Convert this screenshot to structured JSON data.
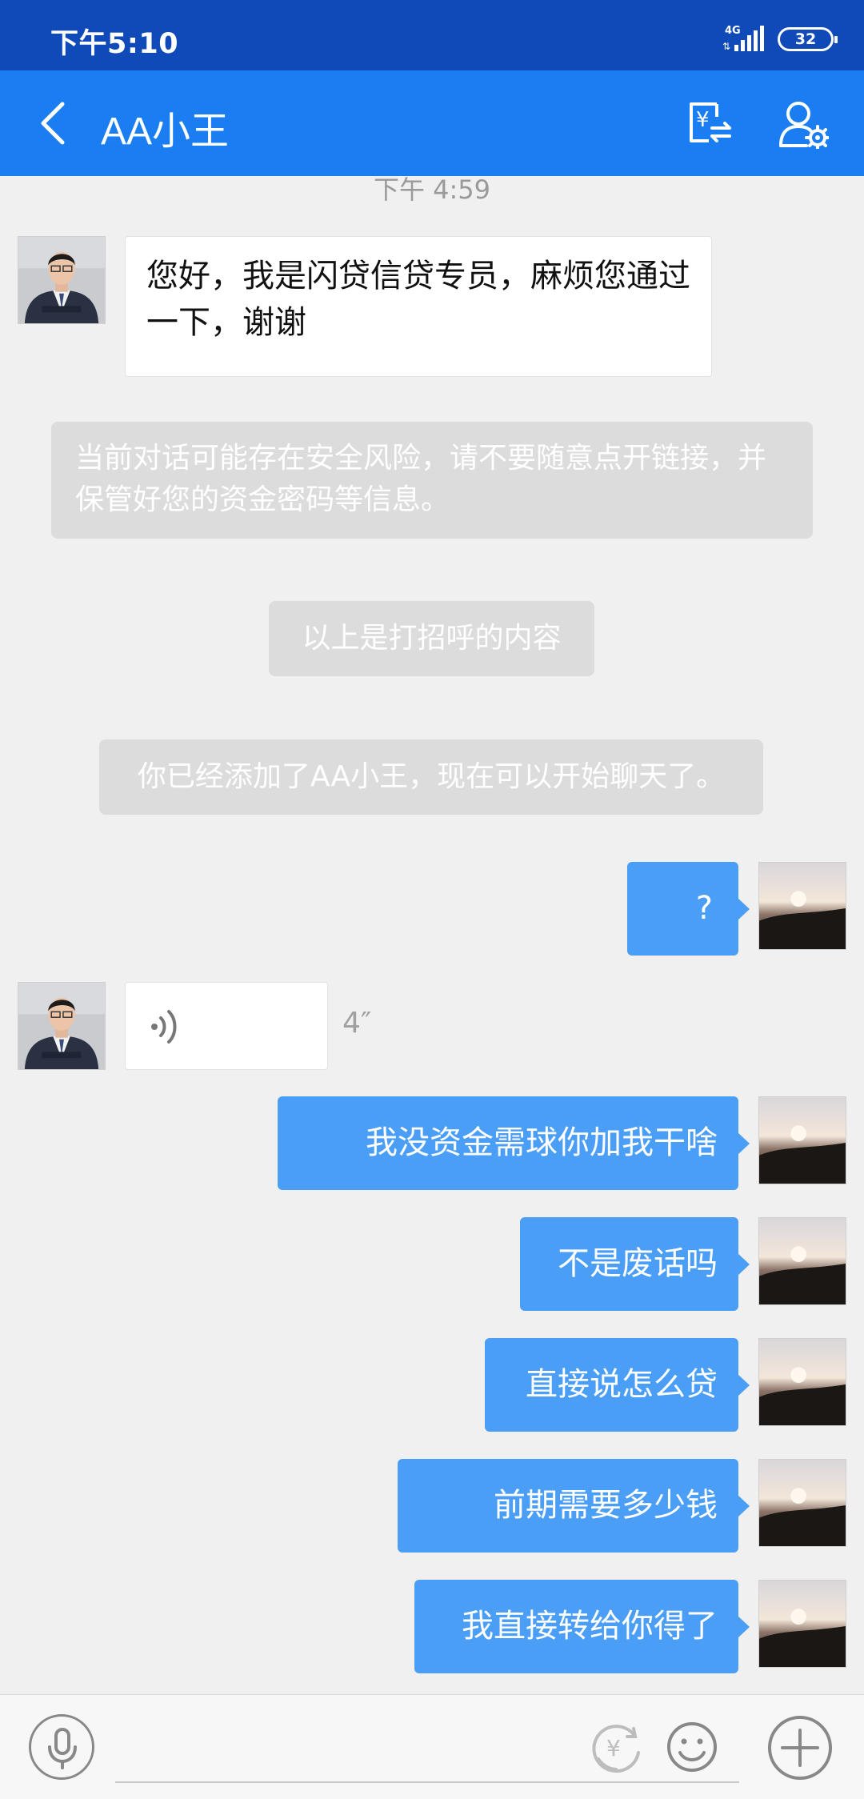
{
  "status_bar": {
    "time": "下午5:10",
    "network": "4G",
    "battery": "32"
  },
  "header": {
    "title": "AA小王"
  },
  "chat": {
    "timestamp": "下午 4:59",
    "messages": [
      {
        "text": "您好，我是闪贷信贷专员，麻烦您通过一下，谢谢"
      },
      {
        "text": "当前对话可能存在安全风险，请不要随意点开链接，并保管好您的资金密码等信息。"
      },
      {
        "text": "以上是打招呼的内容"
      },
      {
        "text": "你已经添加了AA小王，现在可以开始聊天了。"
      },
      {
        "text": "?"
      },
      {
        "duration": "4″"
      },
      {
        "text": "我没资金需球你加我干啥"
      },
      {
        "text": "不是废话吗"
      },
      {
        "text": "直接说怎么贷"
      },
      {
        "text": "前期需要多少钱"
      },
      {
        "text": "我直接转给你得了"
      }
    ]
  },
  "input": {
    "placeholder": ""
  },
  "colors": {
    "status_bar": "#0f4ab8",
    "nav_bar": "#1a7ef2",
    "my_bubble": "#4b9ef5",
    "background": "#f0f0f0"
  },
  "icons": [
    "back-icon",
    "transfer-icon",
    "contact-settings-icon",
    "voice-icon",
    "yuan-icon",
    "emoji-icon",
    "plus-icon"
  ]
}
